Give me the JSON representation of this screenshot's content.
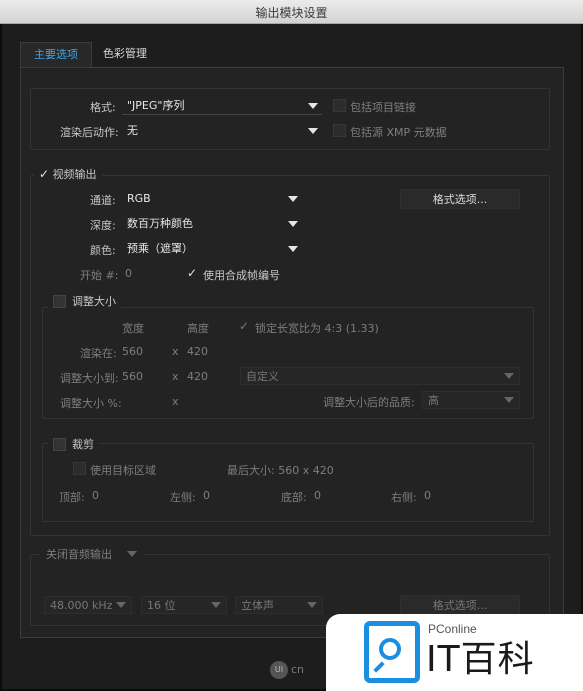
{
  "window": {
    "title": "输出模块设置"
  },
  "tabs": [
    {
      "label": "主要选项"
    },
    {
      "label": "色彩管理"
    }
  ],
  "format": {
    "label": "格式:",
    "value": "\"JPEG\"序列",
    "include_project_link": "包括项目链接"
  },
  "post_render": {
    "label": "渲染后动作:",
    "value": "无",
    "include_xmp": "包括源 XMP 元数据"
  },
  "video": {
    "title": "视频输出",
    "channels_label": "通道:",
    "channels": "RGB",
    "depth_label": "深度:",
    "depth": "数百万种颜色",
    "color_label": "颜色:",
    "color": "预乘（遮罩）",
    "start_label": "开始 #:",
    "start_value": "0",
    "use_comp_frame": "使用合成帧编号",
    "format_options": "格式选项..."
  },
  "resize": {
    "title": "调整大小",
    "width_header": "宽度",
    "height_header": "高度",
    "lock_aspect": "锁定长宽比为 4:3 (1.33)",
    "render_at_label": "渲染在:",
    "render_w": "560",
    "render_h": "420",
    "x": "x",
    "resize_to_label": "调整大小到:",
    "resize_w": "560",
    "resize_h": "420",
    "preset": "自定义",
    "percent_label": "调整大小 %:",
    "quality_label": "调整大小后的品质:",
    "quality": "高"
  },
  "crop": {
    "title": "裁剪",
    "use_roi": "使用目标区域",
    "final_size": "最后大小: 560 x 420",
    "top_label": "顶部:",
    "top": "0",
    "left_label": "左侧:",
    "left": "0",
    "bottom_label": "底部:",
    "bottom": "0",
    "right_label": "右侧:",
    "right": "0"
  },
  "audio": {
    "mode": "关闭音频输出",
    "rate": "48.000 kHz",
    "bits": "16 位",
    "channels": "立体声",
    "format_options": "格式选项..."
  },
  "watermark": {
    "brand_small": "PConline",
    "brand_big": "IT百科",
    "logo_mark": "UI",
    "logo_suffix": "cn"
  }
}
